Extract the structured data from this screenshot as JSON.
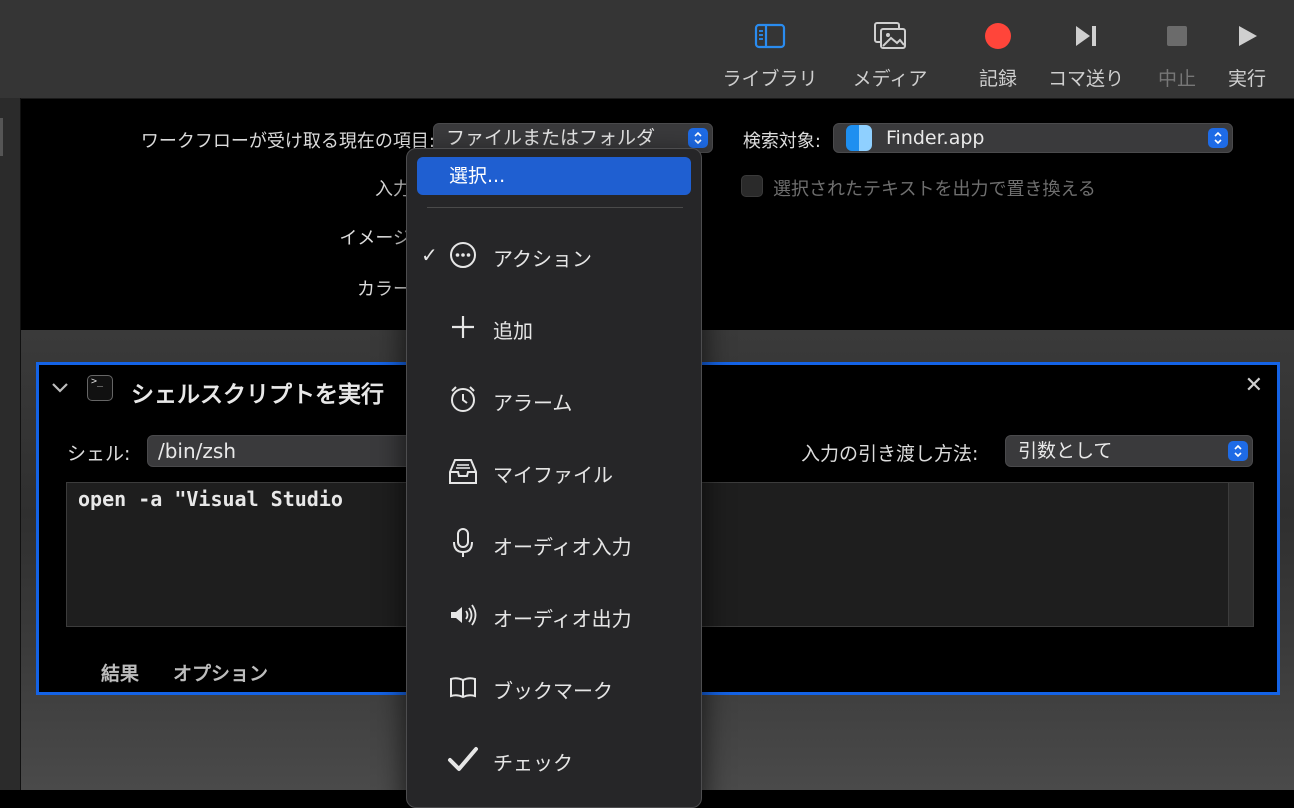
{
  "toolbar": {
    "library": "ライブラリ",
    "media": "メディア",
    "record": "記録",
    "step": "コマ送り",
    "stop": "中止",
    "run": "実行"
  },
  "header": {
    "receives_label": "ワークフローが受け取る現在の項目:",
    "receives_value": "ファイルまたはフォルダ",
    "search_label": "検索対象:",
    "search_value": "Finder.app",
    "input_label": "入力",
    "replace_label": "選択されたテキストを出力で置き換える",
    "image_label": "イメージ",
    "color_label": "カラー"
  },
  "action": {
    "title": "シェルスクリプトを実行",
    "shell_label": "シェル:",
    "shell_value": "/bin/zsh",
    "pass_input_label": "入力の引き渡し方法:",
    "pass_input_value": "引数として",
    "code": "open -a \"Visual Studio",
    "tabs": [
      "結果",
      "オプション"
    ]
  },
  "menu": {
    "selected": "選択...",
    "items": [
      {
        "label": "アクション",
        "icon": "ellipsis-circle-icon",
        "checked": true
      },
      {
        "label": "追加",
        "icon": "plus-icon"
      },
      {
        "label": "アラーム",
        "icon": "alarm-clock-icon"
      },
      {
        "label": "マイファイル",
        "icon": "tray-icon"
      },
      {
        "label": "オーディオ入力",
        "icon": "microphone-icon"
      },
      {
        "label": "オーディオ出力",
        "icon": "speaker-icon"
      },
      {
        "label": "ブックマーク",
        "icon": "book-icon"
      },
      {
        "label": "チェック",
        "icon": "checkmark-icon"
      }
    ]
  },
  "colors": {
    "accent": "#1f5fd1",
    "record": "#ff453a",
    "action_border": "#1463e6"
  }
}
